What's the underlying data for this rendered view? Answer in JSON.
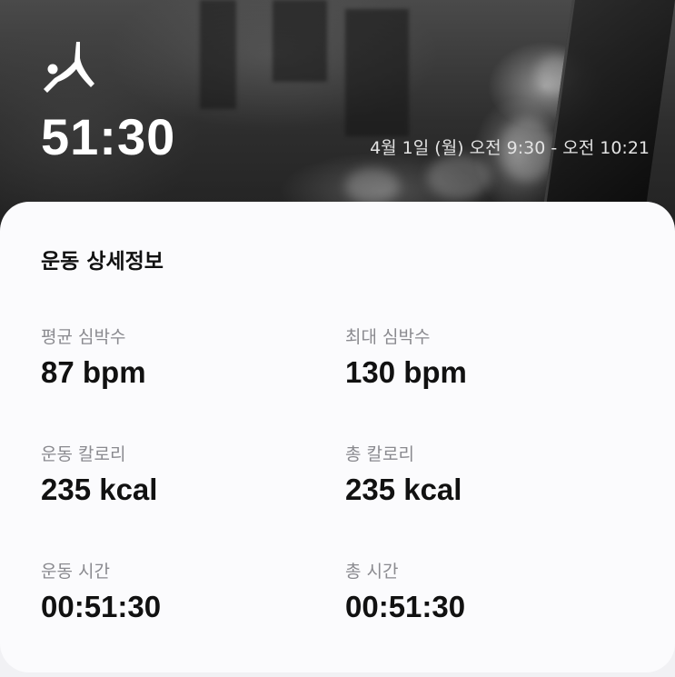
{
  "header": {
    "workout_icon": "stretching-person-icon",
    "duration": "51:30",
    "time_range": "4월 1일 (월) 오전 9:30 - 오전 10:21"
  },
  "details": {
    "title": "운동 상세정보",
    "stats": [
      {
        "label": "평균 심박수",
        "value": "87 bpm"
      },
      {
        "label": "최대 심박수",
        "value": "130 bpm"
      },
      {
        "label": "운동 칼로리",
        "value": "235 kcal"
      },
      {
        "label": "총 칼로리",
        "value": "235 kcal"
      },
      {
        "label": "운동 시간",
        "value": "00:51:30"
      },
      {
        "label": "총 시간",
        "value": "00:51:30"
      }
    ]
  },
  "colors": {
    "card_background": "#fbfbfd",
    "label_text": "#8a8a8f",
    "value_text": "#111111",
    "header_text": "#ffffff"
  }
}
